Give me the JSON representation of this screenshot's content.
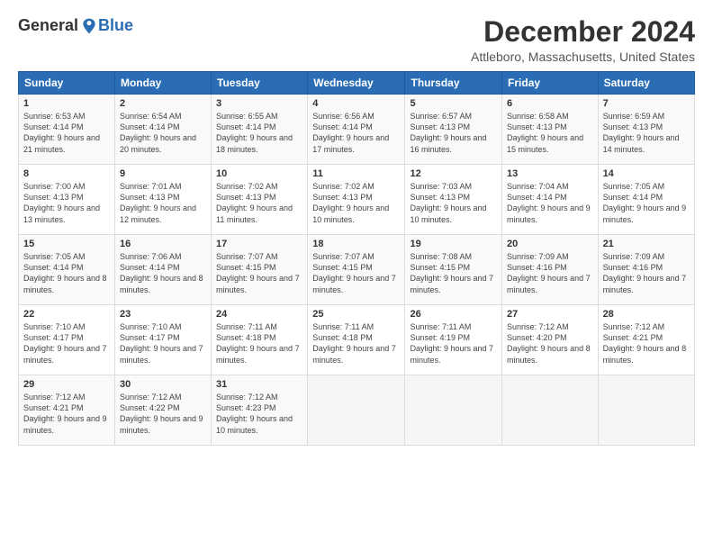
{
  "logo": {
    "general": "General",
    "blue": "Blue"
  },
  "header": {
    "title": "December 2024",
    "location": "Attleboro, Massachusetts, United States"
  },
  "weekdays": [
    "Sunday",
    "Monday",
    "Tuesday",
    "Wednesday",
    "Thursday",
    "Friday",
    "Saturday"
  ],
  "weeks": [
    [
      {
        "day": "1",
        "sunrise": "6:53 AM",
        "sunset": "4:14 PM",
        "daylight": "9 hours and 21 minutes."
      },
      {
        "day": "2",
        "sunrise": "6:54 AM",
        "sunset": "4:14 PM",
        "daylight": "9 hours and 20 minutes."
      },
      {
        "day": "3",
        "sunrise": "6:55 AM",
        "sunset": "4:14 PM",
        "daylight": "9 hours and 18 minutes."
      },
      {
        "day": "4",
        "sunrise": "6:56 AM",
        "sunset": "4:14 PM",
        "daylight": "9 hours and 17 minutes."
      },
      {
        "day": "5",
        "sunrise": "6:57 AM",
        "sunset": "4:13 PM",
        "daylight": "9 hours and 16 minutes."
      },
      {
        "day": "6",
        "sunrise": "6:58 AM",
        "sunset": "4:13 PM",
        "daylight": "9 hours and 15 minutes."
      },
      {
        "day": "7",
        "sunrise": "6:59 AM",
        "sunset": "4:13 PM",
        "daylight": "9 hours and 14 minutes."
      }
    ],
    [
      {
        "day": "8",
        "sunrise": "7:00 AM",
        "sunset": "4:13 PM",
        "daylight": "9 hours and 13 minutes."
      },
      {
        "day": "9",
        "sunrise": "7:01 AM",
        "sunset": "4:13 PM",
        "daylight": "9 hours and 12 minutes."
      },
      {
        "day": "10",
        "sunrise": "7:02 AM",
        "sunset": "4:13 PM",
        "daylight": "9 hours and 11 minutes."
      },
      {
        "day": "11",
        "sunrise": "7:02 AM",
        "sunset": "4:13 PM",
        "daylight": "9 hours and 10 minutes."
      },
      {
        "day": "12",
        "sunrise": "7:03 AM",
        "sunset": "4:13 PM",
        "daylight": "9 hours and 10 minutes."
      },
      {
        "day": "13",
        "sunrise": "7:04 AM",
        "sunset": "4:14 PM",
        "daylight": "9 hours and 9 minutes."
      },
      {
        "day": "14",
        "sunrise": "7:05 AM",
        "sunset": "4:14 PM",
        "daylight": "9 hours and 9 minutes."
      }
    ],
    [
      {
        "day": "15",
        "sunrise": "7:05 AM",
        "sunset": "4:14 PM",
        "daylight": "9 hours and 8 minutes."
      },
      {
        "day": "16",
        "sunrise": "7:06 AM",
        "sunset": "4:14 PM",
        "daylight": "9 hours and 8 minutes."
      },
      {
        "day": "17",
        "sunrise": "7:07 AM",
        "sunset": "4:15 PM",
        "daylight": "9 hours and 7 minutes."
      },
      {
        "day": "18",
        "sunrise": "7:07 AM",
        "sunset": "4:15 PM",
        "daylight": "9 hours and 7 minutes."
      },
      {
        "day": "19",
        "sunrise": "7:08 AM",
        "sunset": "4:15 PM",
        "daylight": "9 hours and 7 minutes."
      },
      {
        "day": "20",
        "sunrise": "7:09 AM",
        "sunset": "4:16 PM",
        "daylight": "9 hours and 7 minutes."
      },
      {
        "day": "21",
        "sunrise": "7:09 AM",
        "sunset": "4:16 PM",
        "daylight": "9 hours and 7 minutes."
      }
    ],
    [
      {
        "day": "22",
        "sunrise": "7:10 AM",
        "sunset": "4:17 PM",
        "daylight": "9 hours and 7 minutes."
      },
      {
        "day": "23",
        "sunrise": "7:10 AM",
        "sunset": "4:17 PM",
        "daylight": "9 hours and 7 minutes."
      },
      {
        "day": "24",
        "sunrise": "7:11 AM",
        "sunset": "4:18 PM",
        "daylight": "9 hours and 7 minutes."
      },
      {
        "day": "25",
        "sunrise": "7:11 AM",
        "sunset": "4:18 PM",
        "daylight": "9 hours and 7 minutes."
      },
      {
        "day": "26",
        "sunrise": "7:11 AM",
        "sunset": "4:19 PM",
        "daylight": "9 hours and 7 minutes."
      },
      {
        "day": "27",
        "sunrise": "7:12 AM",
        "sunset": "4:20 PM",
        "daylight": "9 hours and 8 minutes."
      },
      {
        "day": "28",
        "sunrise": "7:12 AM",
        "sunset": "4:21 PM",
        "daylight": "9 hours and 8 minutes."
      }
    ],
    [
      {
        "day": "29",
        "sunrise": "7:12 AM",
        "sunset": "4:21 PM",
        "daylight": "9 hours and 9 minutes."
      },
      {
        "day": "30",
        "sunrise": "7:12 AM",
        "sunset": "4:22 PM",
        "daylight": "9 hours and 9 minutes."
      },
      {
        "day": "31",
        "sunrise": "7:12 AM",
        "sunset": "4:23 PM",
        "daylight": "9 hours and 10 minutes."
      },
      null,
      null,
      null,
      null
    ]
  ]
}
